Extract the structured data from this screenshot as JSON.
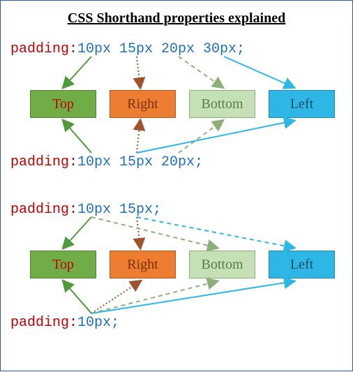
{
  "title": "CSS Shorthand properties explained",
  "lines": {
    "l1_kw": "padding:",
    "l1_val": "10px 15px 20px 30px;",
    "l2_kw": "padding:",
    "l2_val": "10px 15px 20px;",
    "l3_kw": "padding:",
    "l3_val": "10px 15px;",
    "l4_kw": "padding:",
    "l4_val": "10px;"
  },
  "boxes": {
    "top": "Top",
    "right": "Right",
    "bottom": "Bottom",
    "left": "Left"
  }
}
